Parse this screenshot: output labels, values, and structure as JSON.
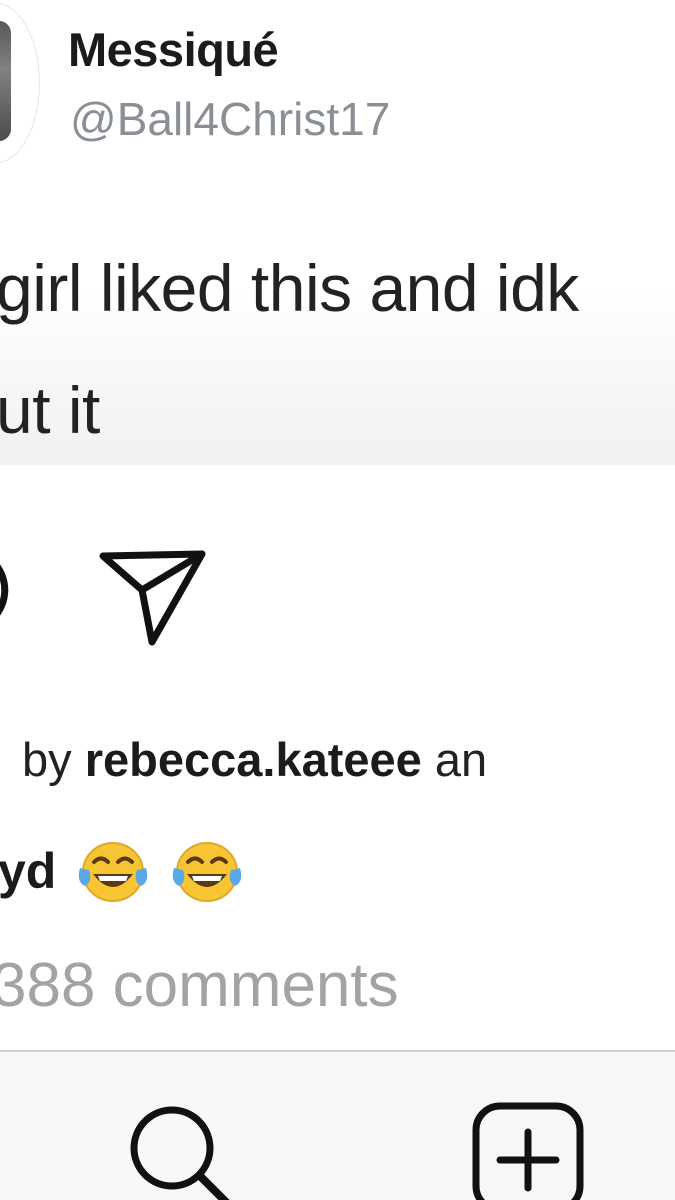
{
  "tweet": {
    "display_name": "Messiqué",
    "handle": "@Ball4Christ17",
    "text_line_1": "girl liked this and idk",
    "text_line_2": "ut it"
  },
  "post": {
    "liked_by_prefix": "by",
    "liked_by_user": "rebecca.kateee",
    "liked_by_suffix": "an",
    "caption_text": "yd",
    "caption_emojis": [
      "face-with-tears-of-joy",
      "face-with-tears-of-joy"
    ],
    "comments_label": "388 comments"
  },
  "actions": {
    "icons": [
      "comment-icon",
      "share-icon"
    ]
  },
  "tab_bar": {
    "icons": [
      "search-icon",
      "add-post-icon"
    ]
  },
  "colors": {
    "text_primary": "#1b1b1b",
    "handle_gray": "#8a8f95",
    "comments_gray": "#a3a3a3",
    "tab_bar_bg": "#f8f8f8",
    "emoji_yellow": "#f7c433",
    "emoji_tear_blue": "#5aa9e6"
  }
}
